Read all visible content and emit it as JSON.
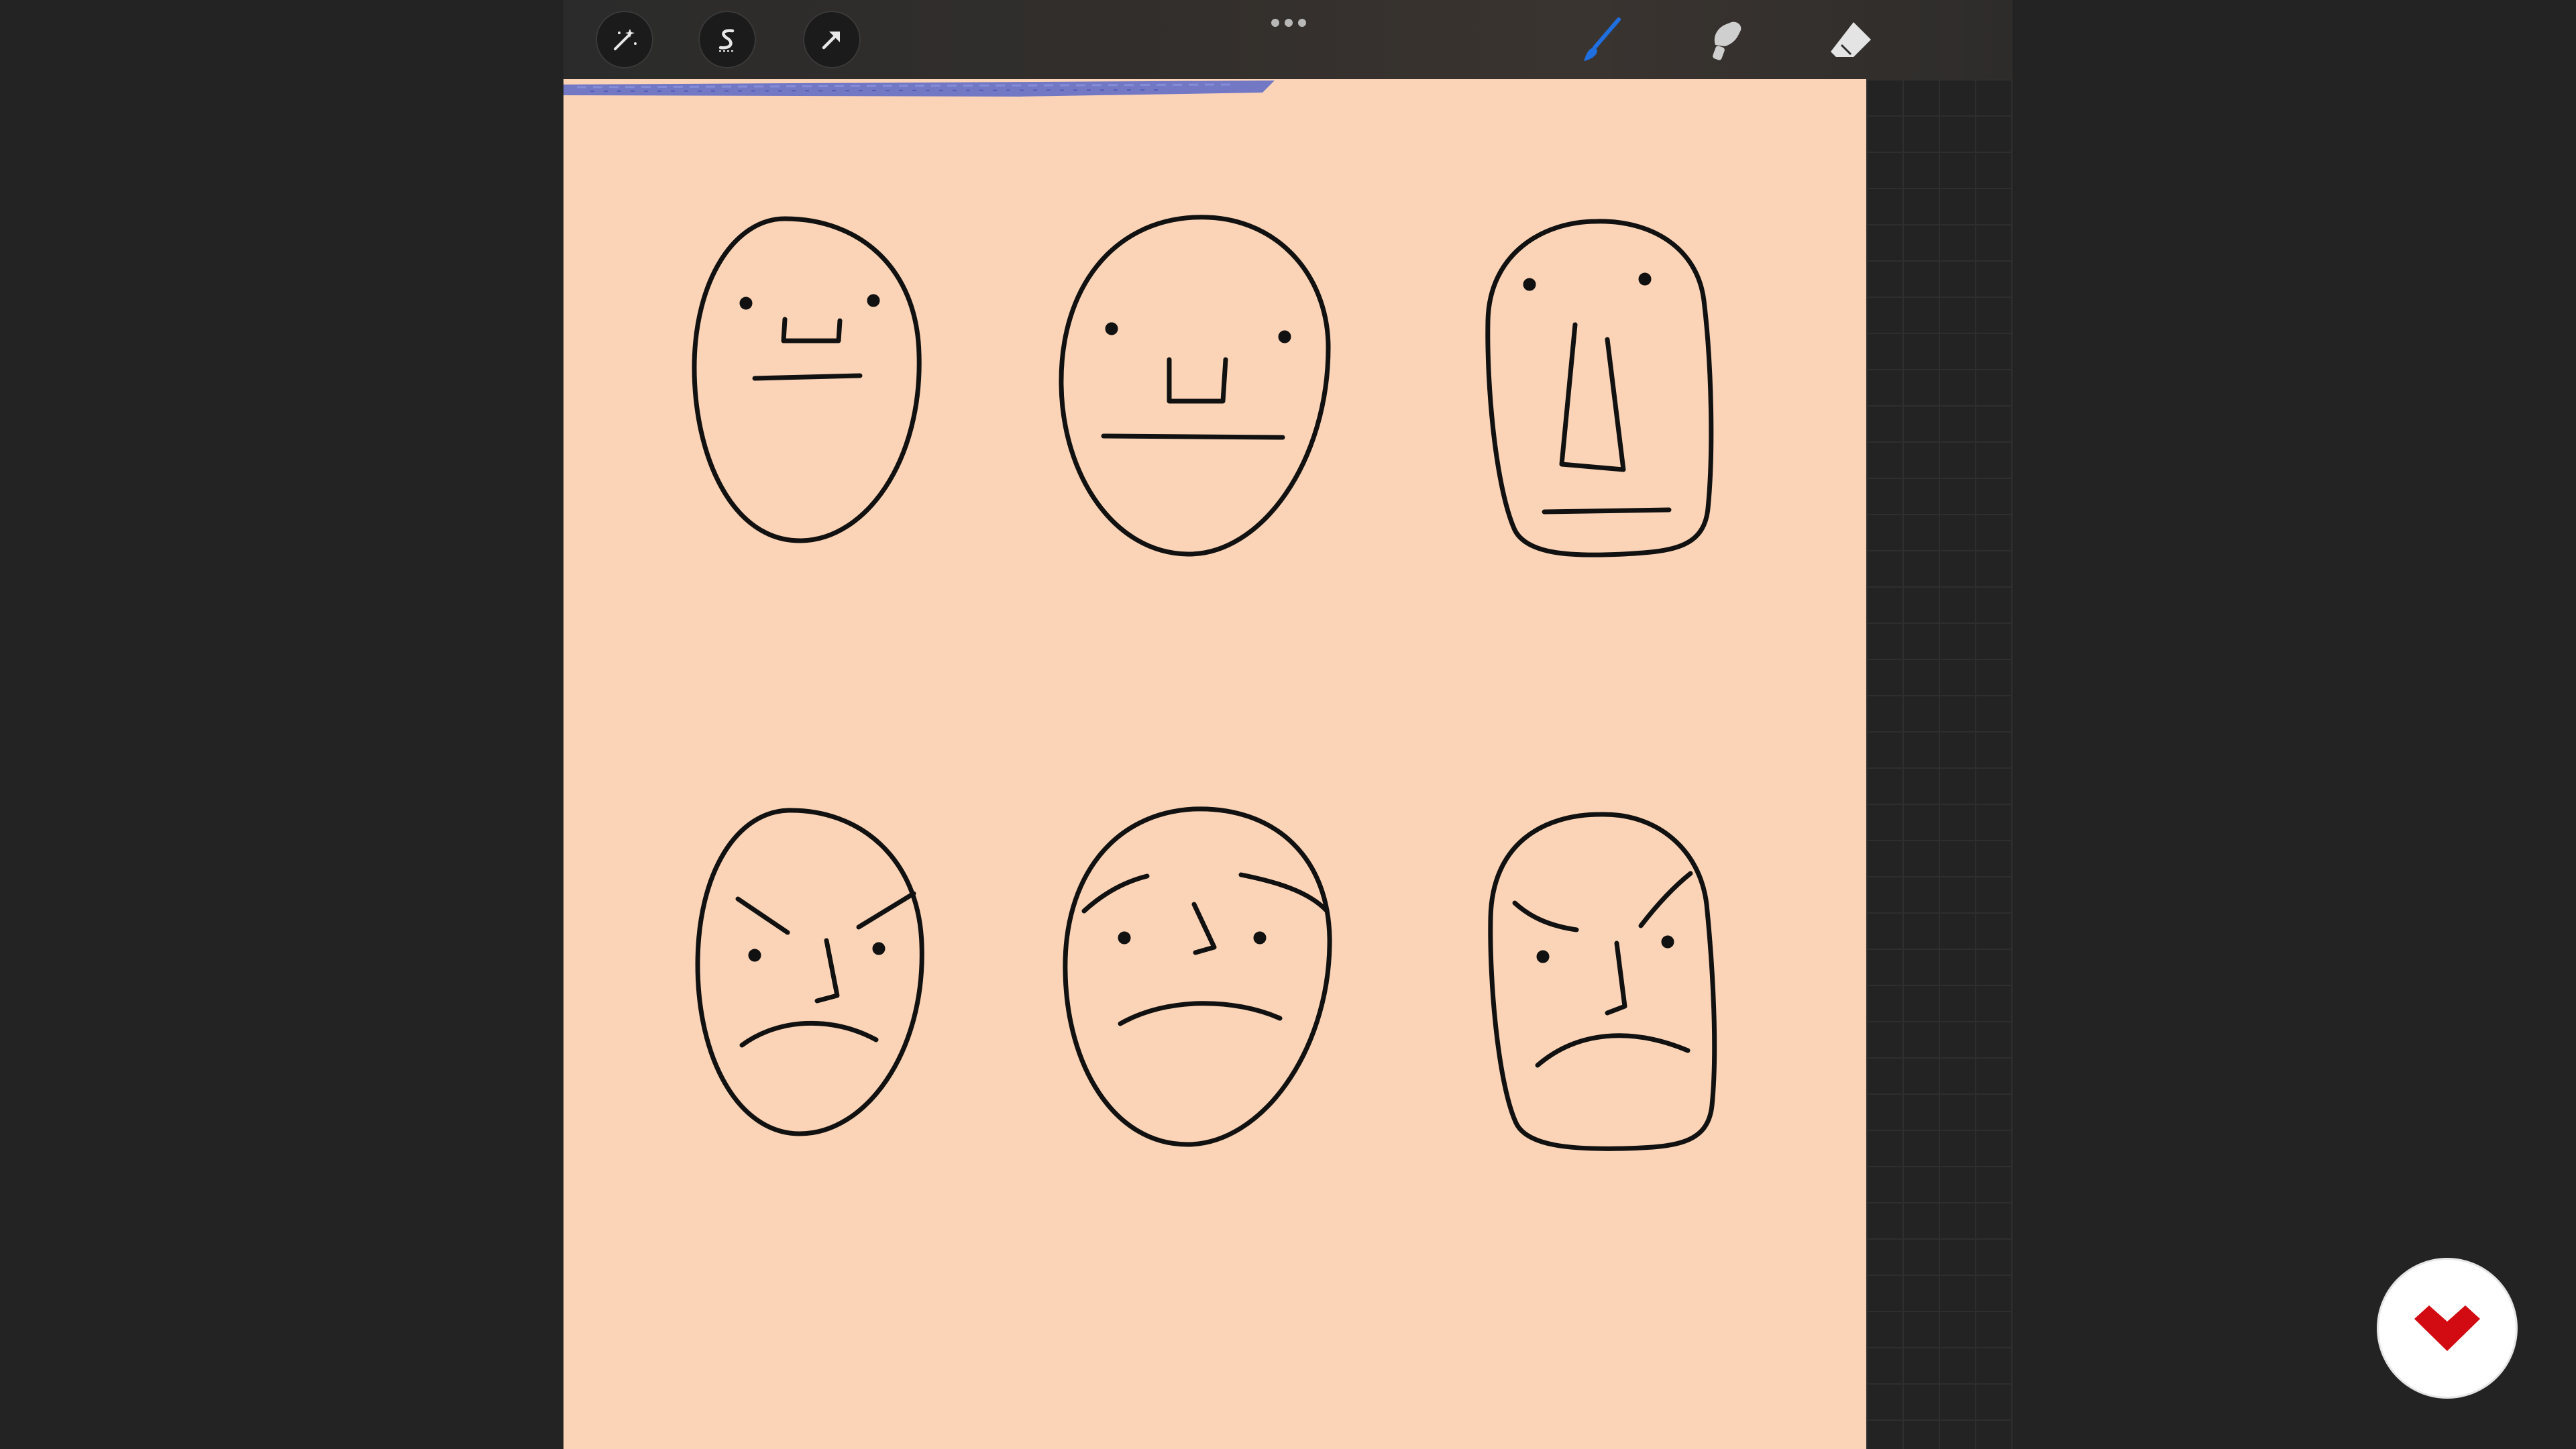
{
  "app": {
    "toolbar": {
      "left_tools": [
        {
          "icon": "adjustments-wand-icon"
        },
        {
          "icon": "selection-s-icon"
        },
        {
          "icon": "transform-arrow-icon"
        }
      ],
      "more_menu_icon": "more-dots-icon",
      "right_tools": [
        {
          "icon": "brush-icon",
          "active": true
        },
        {
          "icon": "smudge-icon",
          "active": false
        },
        {
          "icon": "eraser-icon",
          "active": false
        }
      ]
    },
    "canvas": {
      "background_color": "#fbd4b7",
      "stroke_color": "#111111",
      "top_stroke_color": "#5a67c8",
      "faces": [
        {
          "shape": "oval",
          "expression": "neutral"
        },
        {
          "shape": "oval-large",
          "expression": "neutral"
        },
        {
          "shape": "rect-long-nose",
          "expression": "neutral"
        },
        {
          "shape": "oval",
          "expression": "angry"
        },
        {
          "shape": "oval-large",
          "expression": "sad"
        },
        {
          "shape": "rect",
          "expression": "angry"
        }
      ]
    },
    "accent_color": "#1f6fe0"
  },
  "overlay": {
    "logo_icon": "domestika-logo-icon",
    "logo_color": "#d20a11"
  }
}
